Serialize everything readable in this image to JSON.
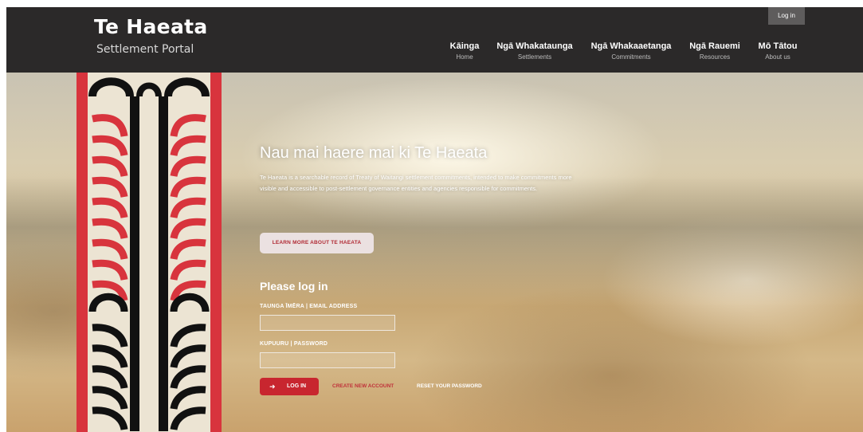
{
  "header": {
    "brand_title": "Te Haeata",
    "brand_subtitle": "Settlement Portal",
    "login_label": "Log in",
    "nav": [
      {
        "main": "Kāinga",
        "sub": "Home"
      },
      {
        "main": "Ngā Whakataunga",
        "sub": "Settlements"
      },
      {
        "main": "Ngā Whakaaetanga",
        "sub": "Commitments"
      },
      {
        "main": "Ngā Rauemi",
        "sub": "Resources"
      },
      {
        "main": "Mō Tātou",
        "sub": "About us"
      }
    ]
  },
  "hero": {
    "welcome": "Nau mai haere mai ki Te Haeata",
    "description": "Te Haeata is a searchable record of Treaty of Waitangi settlement commitments, intended to make commitments more visible and accessible to post-settlement governance entities and agencies responsible for commitments.",
    "learn_more": "LEARN MORE ABOUT TE HAEATA"
  },
  "login": {
    "heading": "Please log in",
    "email_label": "TAUNGA ĪMĒRA | EMAIL ADDRESS",
    "email_value": "",
    "password_label": "KUPUURU | PASSWORD",
    "password_value": "",
    "login_button": "LOG IN",
    "login_icon": "sign-in-icon",
    "create_account": "CREATE NEW ACCOUNT",
    "reset_password": "RESET YOUR PASSWORD"
  },
  "colors": {
    "header_bg": "#2b2929",
    "accent_red": "#c8262f",
    "pattern_red": "#d8343d",
    "pattern_black": "#111111",
    "pattern_bg": "#ece4d3"
  }
}
